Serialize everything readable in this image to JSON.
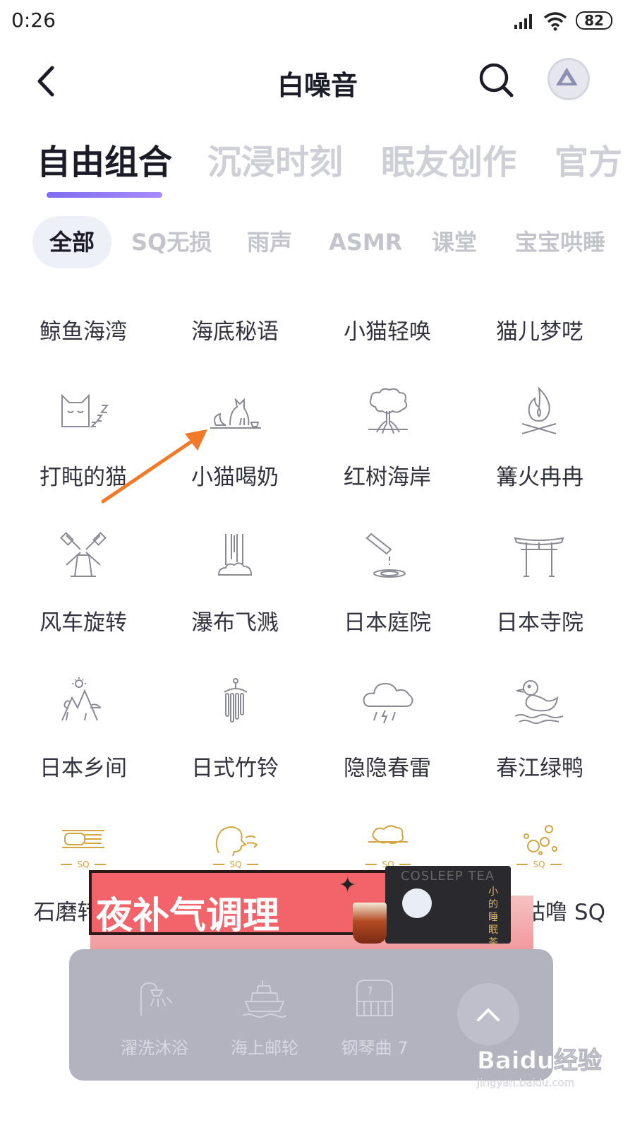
{
  "status_bar": {
    "time": "0:26",
    "battery": "82"
  },
  "header": {
    "title": "白噪音"
  },
  "tabs": [
    "自由组合",
    "沉浸时刻",
    "眠友创作",
    "官方"
  ],
  "chips": [
    "全部",
    "SQ无损",
    "雨声",
    "ASMR",
    "课堂",
    "宝宝哄睡"
  ],
  "grid": {
    "row0": [
      "鲸鱼海湾",
      "海底秘语",
      "小猫轻唤",
      "猫儿梦呓"
    ],
    "row1": [
      "打盹的猫",
      "小猫喝奶",
      "红树海岸",
      "篝火冉冉"
    ],
    "row2": [
      "风车旋转",
      "瀑布飞溅",
      "日本庭院",
      "日本寺院"
    ],
    "row3": [
      "日本乡间",
      "日式竹铃",
      "隐隐春雷",
      "春江绿鸭"
    ],
    "row4": [
      "石磨转",
      "咕噜 SQ"
    ],
    "icons": {
      "row1": [
        "sleeping-cat-icon",
        "cat-drinking-milk-icon",
        "mangrove-tree-icon",
        "campfire-icon"
      ],
      "row2": [
        "windmill-icon",
        "waterfall-icon",
        "japanese-garden-icon",
        "torii-gate-icon"
      ],
      "row3": [
        "mountain-village-icon",
        "wind-chime-icon",
        "thunder-cloud-icon",
        "duck-icon"
      ],
      "row4": [
        "millstone-sq-icon",
        "person-breathing-sq-icon",
        "cloud-island-sq-icon",
        "bubbles-sq-icon"
      ]
    },
    "sq_badge": "SQ"
  },
  "ad": {
    "headline": "夜补气调理",
    "box_brand": "COSLEEP TEA",
    "box_cn": "小的睡眠茶"
  },
  "player": {
    "items": [
      {
        "label": "濯洗沐浴",
        "icon": "shower-icon"
      },
      {
        "label": "海上邮轮",
        "icon": "cruise-ship-icon"
      },
      {
        "label": "钢琴曲 7",
        "icon": "piano-icon"
      }
    ]
  },
  "watermark": {
    "logo": "Baidu经验",
    "url": "jingyan.baidu.com"
  },
  "colors": {
    "accent": "#8b78f2",
    "sq_gold": "#d4a541",
    "icon_gray": "#8a8a94"
  }
}
